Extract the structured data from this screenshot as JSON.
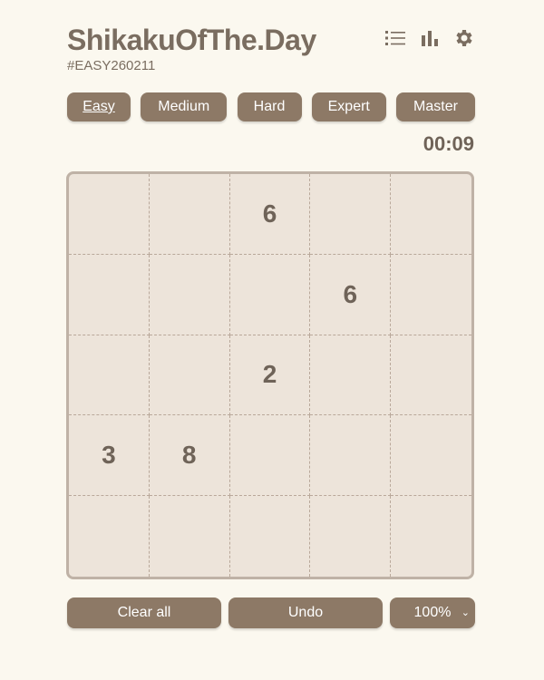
{
  "app": {
    "title": "ShikakuOfThe.Day",
    "puzzle_id": "#EASY260211"
  },
  "toolbar": {
    "icons": [
      "list-icon",
      "stats-icon",
      "gear-icon"
    ]
  },
  "difficulty": {
    "active": "Easy",
    "levels": [
      "Easy",
      "Medium",
      "Hard",
      "Expert",
      "Master"
    ]
  },
  "timer": "00:09",
  "board": {
    "size": 5,
    "rows": [
      [
        "",
        "",
        "6",
        "",
        ""
      ],
      [
        "",
        "",
        "",
        "6",
        ""
      ],
      [
        "",
        "",
        "2",
        "",
        ""
      ],
      [
        "3",
        "8",
        "",
        "",
        ""
      ],
      [
        "",
        "",
        "",
        "",
        ""
      ]
    ]
  },
  "footer": {
    "clear_label": "Clear all",
    "undo_label": "Undo",
    "zoom_value": "100%",
    "zoom_chevron": "⌄"
  },
  "colors": {
    "background": "#fbf8ef",
    "button": "#8d7966",
    "board": "#ede4da",
    "board_border": "#bfb2a6",
    "text": "#7a6d60"
  }
}
